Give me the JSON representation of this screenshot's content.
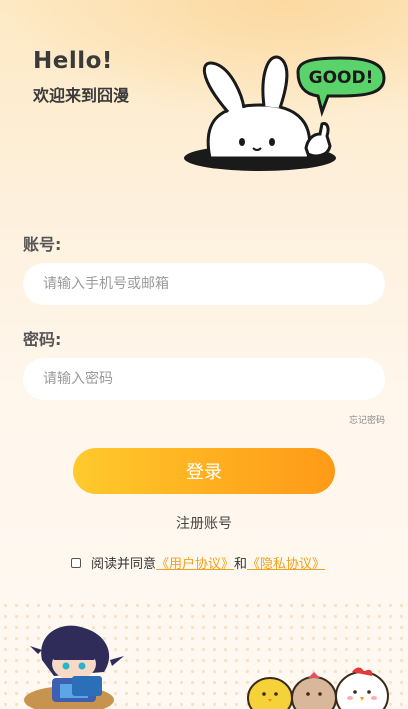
{
  "header": {
    "hello": "Hello!",
    "welcome": "欢迎来到囧漫",
    "bubble_text": "GOOD!"
  },
  "account": {
    "label": "账号:",
    "placeholder": "请输入手机号或邮箱",
    "value": ""
  },
  "password": {
    "label": "密码:",
    "placeholder": "请输入密码",
    "value": ""
  },
  "forgot_label": "忘记密码",
  "login_label": "登录",
  "register_label": "注册账号",
  "agreement": {
    "prefix": "阅读并同意",
    "user_agreement": "《用户协议》",
    "joiner": "和",
    "privacy_agreement": "《隐私协议》",
    "checked": false
  },
  "colors": {
    "accent": "#ffac1f",
    "link": "#f0a21a"
  }
}
